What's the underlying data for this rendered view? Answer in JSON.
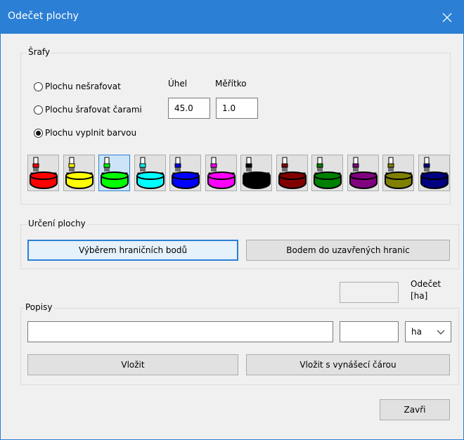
{
  "window": {
    "title": "Odečet plochy"
  },
  "hatch": {
    "group_label": "Šrafy",
    "options": [
      {
        "label": "Plochu nešrafovat",
        "checked": false
      },
      {
        "label": "Plochu šrafovat čarami",
        "checked": false
      },
      {
        "label": "Plochu vyplnit barvou",
        "checked": true
      }
    ],
    "angle_label": "Úhel",
    "angle_value": "45.0",
    "scale_label": "Měřítko",
    "scale_value": "1.0",
    "colors": [
      {
        "name": "red",
        "hex": "#ff0000"
      },
      {
        "name": "yellow",
        "hex": "#ffff00"
      },
      {
        "name": "green",
        "hex": "#00ff00"
      },
      {
        "name": "cyan",
        "hex": "#00ffff"
      },
      {
        "name": "blue",
        "hex": "#0000ff"
      },
      {
        "name": "magenta",
        "hex": "#ff00ff"
      },
      {
        "name": "black",
        "hex": "#000000"
      },
      {
        "name": "dark-red",
        "hex": "#800000"
      },
      {
        "name": "dark-green",
        "hex": "#008000"
      },
      {
        "name": "purple",
        "hex": "#800080"
      },
      {
        "name": "olive",
        "hex": "#808000"
      },
      {
        "name": "navy",
        "hex": "#000080"
      }
    ],
    "selected_color_index": 2
  },
  "area": {
    "group_label": "Určení plochy",
    "by_boundary_points": "Výběrem hraničních bodů",
    "by_point_inside": "Bodem do uzavřených hranic"
  },
  "result": {
    "label_line1": "Odečet",
    "label_line2": "[ha]",
    "value": ""
  },
  "labels": {
    "group_label": "Popisy",
    "text_value": "",
    "number_value": "",
    "unit_selected": "ha",
    "insert": "Vložit",
    "insert_with_leader": "Vložit s vynášecí čárou"
  },
  "footer": {
    "close": "Zavři"
  }
}
